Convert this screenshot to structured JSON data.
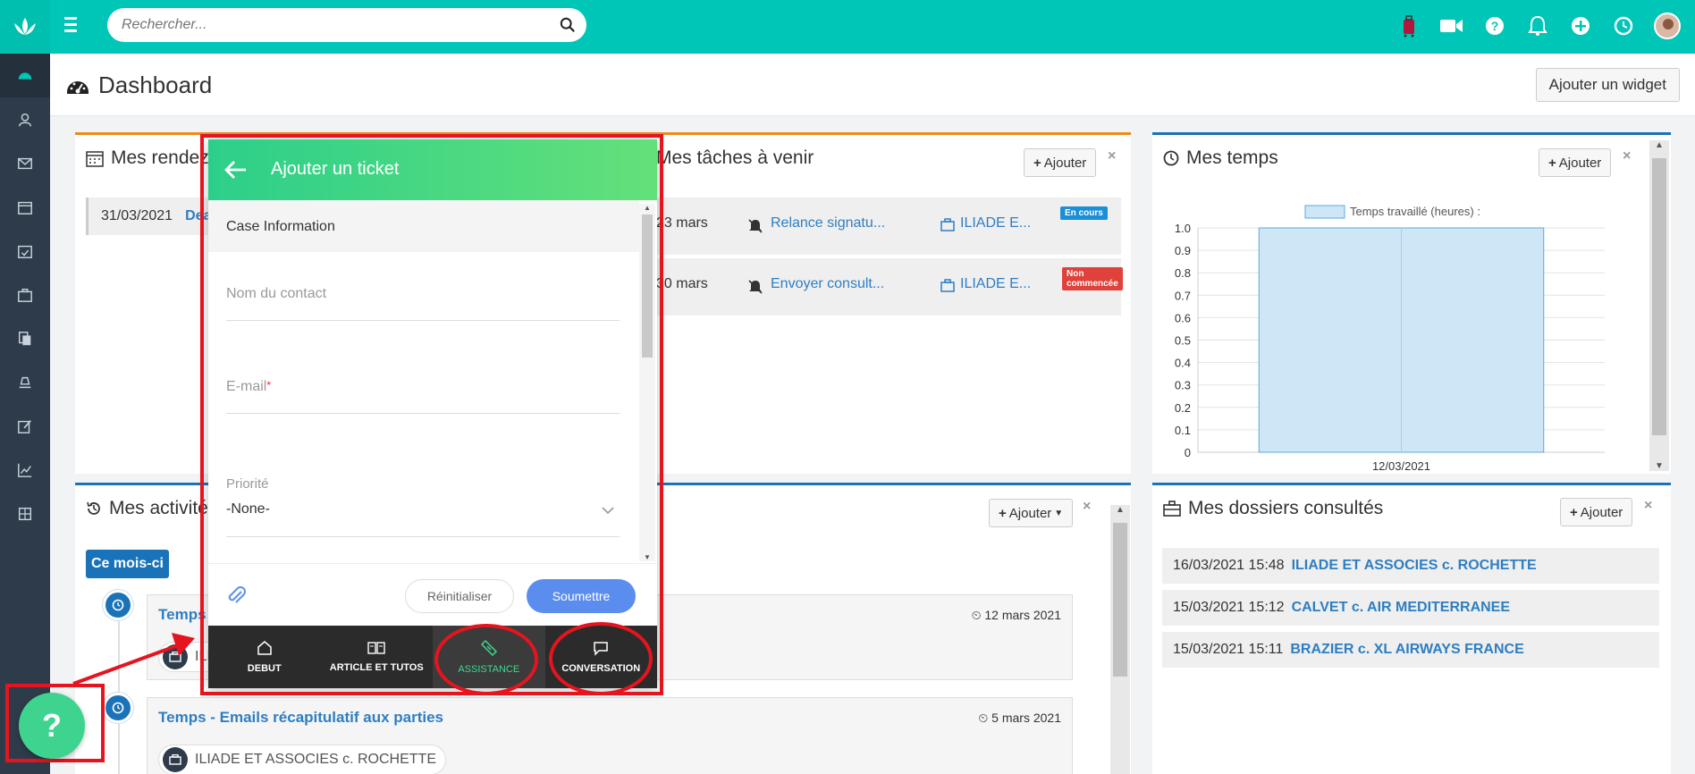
{
  "search": {
    "placeholder": "Rechercher..."
  },
  "page": {
    "title": "Dashboard",
    "add_widget_label": "Ajouter un widget"
  },
  "rendezvous": {
    "title": "Mes rendez-",
    "row_date": "31/03/2021",
    "row_link": "Dead"
  },
  "taches": {
    "title": "Mes tâches à venir",
    "add_label": "Ajouter",
    "rows": [
      {
        "date": "23 mars",
        "task": "Relance signatu...",
        "case": "ILIADE E...",
        "status": "En cours",
        "status_color": "#1a8fd8"
      },
      {
        "date": "30 mars",
        "task": "Envoyer consult...",
        "case": "ILIADE E...",
        "status": "Non commencée",
        "status_color": "#e0413a"
      }
    ]
  },
  "temps": {
    "title": "Mes temps",
    "add_label": "Ajouter"
  },
  "chart_data": {
    "type": "bar",
    "categories": [
      "12/03/2021"
    ],
    "series": [
      {
        "name": "Temps travaillé (heures) :",
        "values": [
          1.0
        ]
      }
    ],
    "ylim": [
      0,
      1.0
    ],
    "yticks": [
      "1.0",
      "0.9",
      "0.8",
      "0.7",
      "0.6",
      "0.5",
      "0.4",
      "0.3",
      "0.2",
      "0.1",
      "0"
    ],
    "legend": "top",
    "color": "#cfe6f7",
    "grid": true
  },
  "activites": {
    "title": "Mes activités",
    "add_label": "Ajouter",
    "filter_label": "Ce mois-ci",
    "items": [
      {
        "title": "Temps",
        "date": "12 mars 2021",
        "case": "ILIA"
      },
      {
        "title": "Temps - Emails récapitulatif aux parties",
        "date": "5 mars 2021",
        "case": "ILIADE ET ASSOCIES c. ROCHETTE"
      }
    ]
  },
  "dossiers": {
    "title": "Mes dossiers consultés",
    "add_label": "Ajouter",
    "rows": [
      {
        "date": "16/03/2021 15:48",
        "name": "ILIADE ET ASSOCIES c. ROCHETTE"
      },
      {
        "date": "15/03/2021 15:12",
        "name": "CALVET c. AIR MEDITERRANEE"
      },
      {
        "date": "15/03/2021 15:11",
        "name": "BRAZIER c. XL AIRWAYS FRANCE"
      }
    ]
  },
  "ticket": {
    "title": "Ajouter un ticket",
    "section": "Case Information",
    "contact_label": "Nom du contact",
    "email_label": "E-mail",
    "required_mark": "*",
    "priority_label": "Priorité",
    "priority_value": "-None-",
    "reset_label": "Réinitialiser",
    "submit_label": "Soumettre",
    "nav": [
      {
        "label": "DEBUT",
        "icon": "home-icon"
      },
      {
        "label": "ARTICLE ET TUTOS",
        "icon": "book-icon"
      },
      {
        "label": "ASSISTANCE",
        "icon": "ticket-icon"
      },
      {
        "label": "CONVERSATION",
        "icon": "chat-icon"
      }
    ]
  },
  "help": {
    "label": "?"
  },
  "colors": {
    "topbar": "#00c6b7",
    "sidebar": "#2e3b4a",
    "annotation": "#e5141f",
    "link": "#2e7ec2"
  }
}
